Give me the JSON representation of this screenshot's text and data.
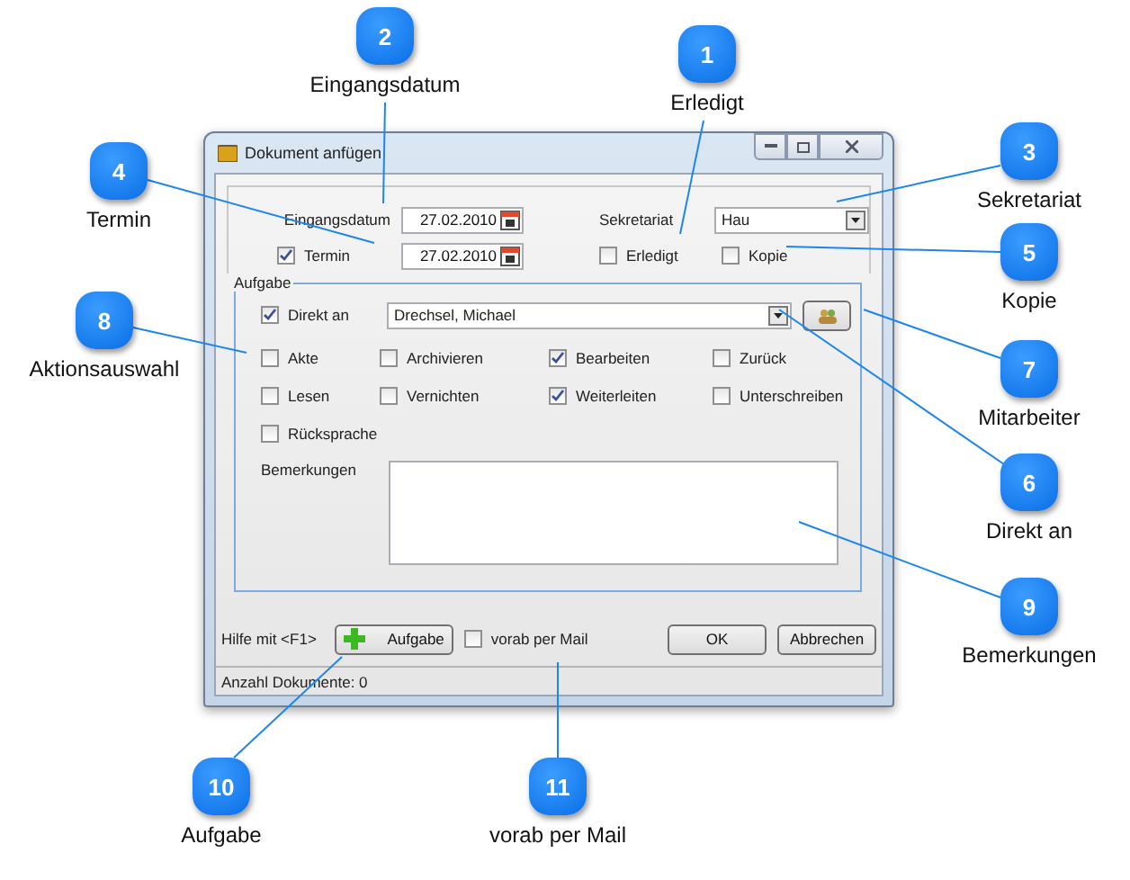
{
  "window": {
    "title": "Dokument anfügen"
  },
  "header": {
    "eingangsdatum_label": "Eingangsdatum",
    "eingangsdatum": "27.02.2010",
    "sekretariat_label": "Sekretariat",
    "sekretariat": "Hau",
    "termin": {
      "label": "Termin",
      "checked": true
    },
    "termin_datum": "27.02.2010",
    "erledigt": {
      "label": "Erledigt",
      "checked": false
    },
    "kopie": {
      "label": "Kopie",
      "checked": false
    }
  },
  "aufgabe": {
    "legend": "Aufgabe",
    "direkt_an": {
      "label": "Direkt an",
      "checked": true
    },
    "mitarbeiter": "Drechsel, Michael",
    "actions": [
      {
        "label": "Akte",
        "checked": false
      },
      {
        "label": "Archivieren",
        "checked": false
      },
      {
        "label": "Bearbeiten",
        "checked": true
      },
      {
        "label": "Zurück",
        "checked": false
      },
      {
        "label": "Lesen",
        "checked": false
      },
      {
        "label": "Vernichten",
        "checked": false
      },
      {
        "label": "Weiterleiten",
        "checked": true
      },
      {
        "label": "Unterschreiben",
        "checked": false
      },
      {
        "label": "Rücksprache",
        "checked": false
      }
    ],
    "bemerkungen_label": "Bemerkungen"
  },
  "footer": {
    "hilfe": "Hilfe mit <F1>",
    "aufgabe_button": "Aufgabe",
    "vorab": {
      "label": "vorab per Mail",
      "checked": false
    },
    "buttons": [
      "OK",
      "Abbrechen"
    ]
  },
  "status_bar": "Anzahl Dokumente: 0",
  "callouts": [
    {
      "number": "2",
      "label": "Eingangsdatum"
    },
    {
      "number": "1",
      "label": "Erledigt"
    },
    {
      "number": "3",
      "label": "Sekretariat"
    },
    {
      "number": "4",
      "label": "Termin"
    },
    {
      "number": "5",
      "label": "Kopie"
    },
    {
      "number": "8",
      "label": "Aktionsauswahl"
    },
    {
      "number": "7",
      "label": "Mitarbeiter"
    },
    {
      "number": "6",
      "label": "Direkt an"
    },
    {
      "number": "9",
      "label": "Bemerkungen"
    },
    {
      "number": "10",
      "label": "Aufgabe"
    },
    {
      "number": "11",
      "label": "vorab per Mail"
    }
  ]
}
